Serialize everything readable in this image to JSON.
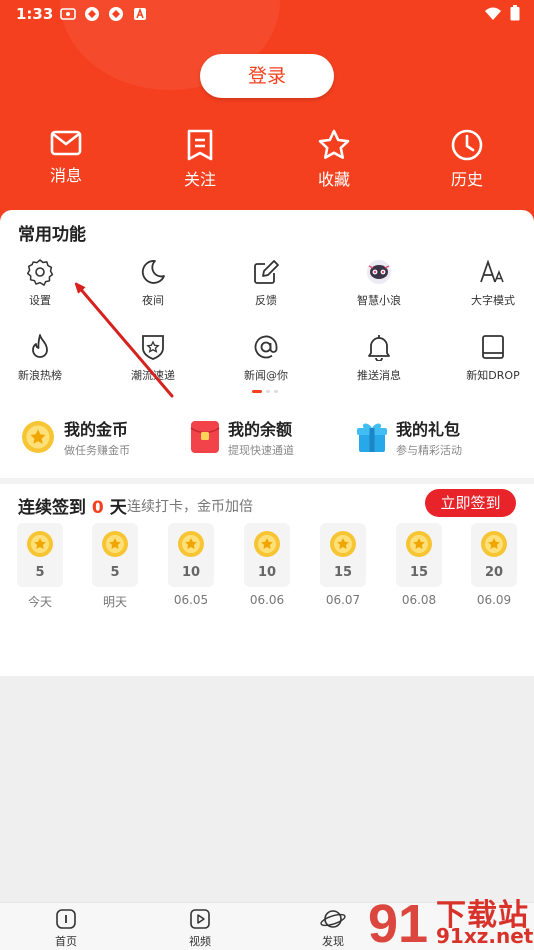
{
  "status_bar": {
    "time": "1:33"
  },
  "header": {
    "login_label": "登录"
  },
  "quick_actions": [
    {
      "label": "消息",
      "icon": "mail-icon"
    },
    {
      "label": "关注",
      "icon": "bookmark-icon"
    },
    {
      "label": "收藏",
      "icon": "star-icon"
    },
    {
      "label": "历史",
      "icon": "clock-icon"
    }
  ],
  "functions": {
    "title": "常用功能",
    "items": [
      {
        "label": "设置",
        "icon": "gear-icon"
      },
      {
        "label": "夜间",
        "icon": "moon-icon"
      },
      {
        "label": "反馈",
        "icon": "edit-icon"
      },
      {
        "label": "智慧小浪",
        "icon": "mascot-icon"
      },
      {
        "label": "大字模式",
        "icon": "font-size-icon"
      },
      {
        "label": "新浪热榜",
        "icon": "flame-icon"
      },
      {
        "label": "潮流速递",
        "icon": "trend-badge-icon"
      },
      {
        "label": "新闻@你",
        "icon": "at-icon"
      },
      {
        "label": "推送消息",
        "icon": "bell-icon"
      },
      {
        "label": "新知DROP",
        "icon": "book-icon"
      }
    ]
  },
  "wallet": [
    {
      "title": "我的金币",
      "sub": "做任务赚金币",
      "icon": "coin-icon"
    },
    {
      "title": "我的余额",
      "sub": "提现快速通道",
      "icon": "red-envelope-icon"
    },
    {
      "title": "我的礼包",
      "sub": "参与精彩活动",
      "icon": "gift-icon"
    }
  ],
  "signin": {
    "prefix": "连续签到",
    "days": "0",
    "suffix": "天",
    "subtitle": "连续打卡，金币加倍",
    "button": "立即签到",
    "schedule": [
      {
        "amount": "5",
        "label": "今天"
      },
      {
        "amount": "5",
        "label": "明天"
      },
      {
        "amount": "10",
        "label": "06.05"
      },
      {
        "amount": "10",
        "label": "06.06"
      },
      {
        "amount": "15",
        "label": "06.07"
      },
      {
        "amount": "15",
        "label": "06.08"
      },
      {
        "amount": "20",
        "label": "06.09"
      }
    ]
  },
  "bottom_nav": [
    {
      "label": "首页",
      "icon": "home-icon"
    },
    {
      "label": "视频",
      "icon": "video-icon"
    },
    {
      "label": "发现",
      "icon": "planet-icon"
    }
  ],
  "watermark": {
    "title": "下载站",
    "url": "91xz.net",
    "logo_text": "91"
  },
  "colors": {
    "brand": "#f5401f",
    "sign_button": "#e8232a",
    "coin": "#f7c533"
  }
}
